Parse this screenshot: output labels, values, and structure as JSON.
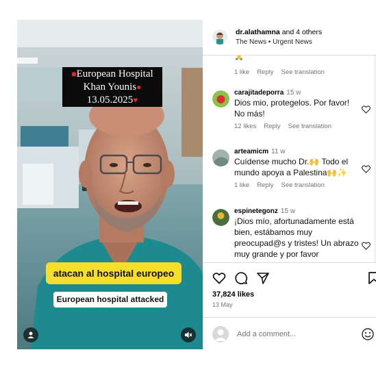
{
  "video": {
    "title_line1": "European Hospital",
    "title_line2": "Khan Younis",
    "title_line3": "13.05.2025",
    "caption_spanish": "atacan al hospital europeo",
    "caption_english": "European hospital attacked"
  },
  "header": {
    "username": "dr.alathamna",
    "and_others": " and 4 others",
    "subtitle": "The News • Urgent News"
  },
  "comments": {
    "top_meta": {
      "likes": "1 like",
      "reply": "Reply",
      "translation": "See translation"
    },
    "items": [
      {
        "username": "carajitadeporra",
        "time": "15 w",
        "text": "Dios mio, protegelos. Por favor! No más!",
        "likes": "12 likes",
        "reply": "Reply",
        "translation": "See translation"
      },
      {
        "username": "arteamicm",
        "time": "11 w",
        "text": "Cuídense mucho Dr.🙌 Todo el mundo apoya a Palestina🙌✨",
        "likes": "1 like",
        "reply": "Reply",
        "translation": "See translation"
      },
      {
        "username": "espinetegonz",
        "time": "15 w",
        "text": "¡Dios mío, afortunadamente está bien, estábamos muy preocupad@s y tristes! Un abrazo muy grande y por favor"
      }
    ]
  },
  "actions": {
    "likes": "37,824 likes",
    "date": "13 May"
  },
  "add_comment": {
    "placeholder": "Add a comment..."
  },
  "colors": {
    "video_caption_bg": "#f7de29",
    "scrubs": "#1c8a8f",
    "meta_text": "#737373"
  }
}
